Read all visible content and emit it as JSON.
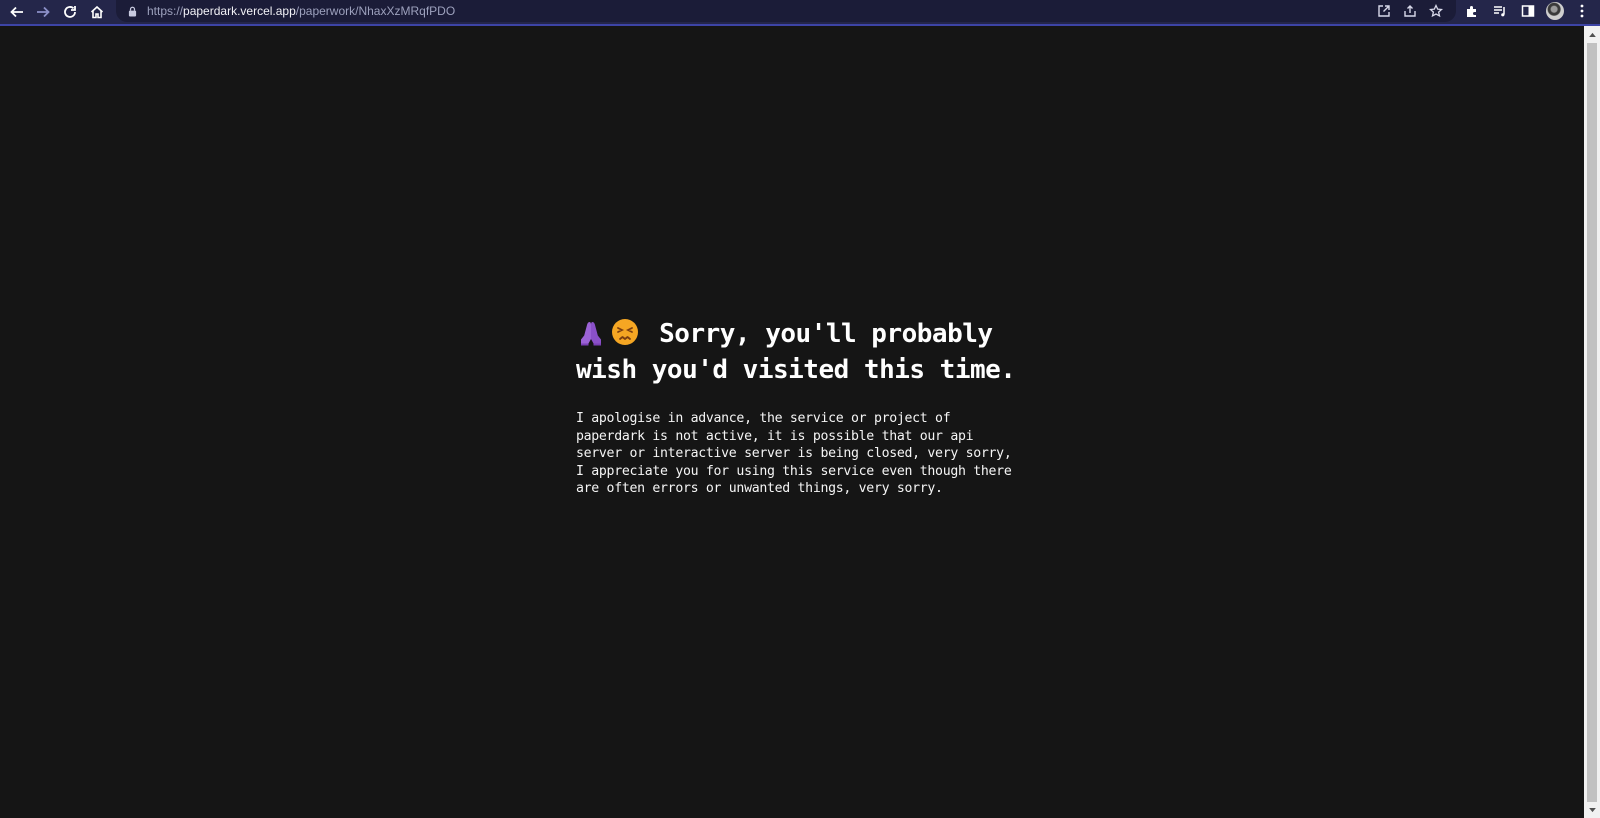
{
  "browser": {
    "url_scheme": "https://",
    "url_host": "paperdark.vercel.app",
    "url_path": "/paperwork/NhaxXzMRqfPDO",
    "icons": {
      "back": "arrow-left-icon",
      "forward": "arrow-right-icon",
      "reload": "reload-icon",
      "home": "home-icon",
      "lock": "lock-icon",
      "open_in_app": "open-external-icon",
      "share": "share-icon",
      "bookmark": "star-icon",
      "extensions": "puzzle-icon",
      "reading_list": "reading-list-icon",
      "side_panel": "side-panel-icon",
      "profile": "avatar",
      "menu": "kebab-menu-icon"
    },
    "colors": {
      "toolbar": "#24264a",
      "accent": "#3d44a6"
    }
  },
  "page": {
    "emojis": [
      "folded-hands-icon",
      "persevering-face-icon"
    ],
    "headline": "Sorry, you'll probably wish you'd visited this time.",
    "message": "I apologise in advance, the service or project of paperdark is not active, it is possible that our api server or interactive server is being closed, very sorry, I appreciate you for using this service even though there are often errors or unwanted things, very sorry.",
    "colors": {
      "background": "#151515",
      "text": "#ffffff"
    }
  }
}
